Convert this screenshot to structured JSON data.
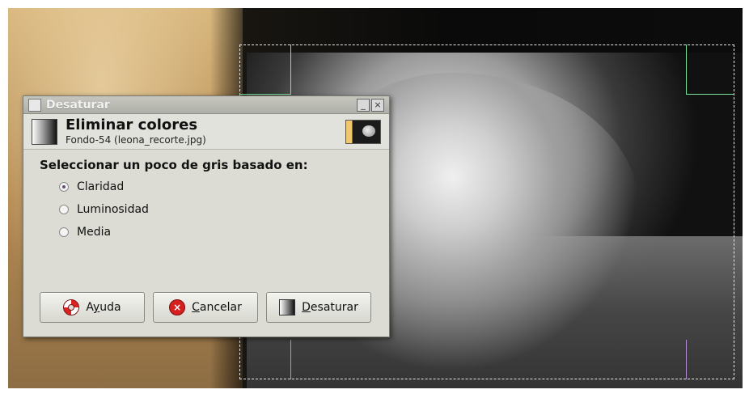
{
  "dialog": {
    "window_title": "Desaturar",
    "header": {
      "title": "Eliminar colores",
      "subtitle": "Fondo-54 (leona_recorte.jpg)"
    },
    "question": "Seleccionar un poco de gris basado en:",
    "options": [
      {
        "label": "Claridad",
        "selected": true
      },
      {
        "label": "Luminosidad",
        "selected": false
      },
      {
        "label": "Media",
        "selected": false
      }
    ],
    "buttons": {
      "help": {
        "prefix": "A",
        "u": "y",
        "rest": "uda"
      },
      "cancel": {
        "prefix": "",
        "u": "C",
        "rest": "ancelar"
      },
      "ok": {
        "prefix": "",
        "u": "D",
        "rest": "esaturar"
      }
    },
    "titlebar_controls": {
      "minimize": "_",
      "close": "×"
    }
  },
  "icons": {
    "window": "window-icon",
    "desaturate": "desaturate-icon",
    "thumbnail": "image-thumbnail-icon",
    "help": "lifebuoy-icon",
    "cancel": "cancel-icon"
  }
}
